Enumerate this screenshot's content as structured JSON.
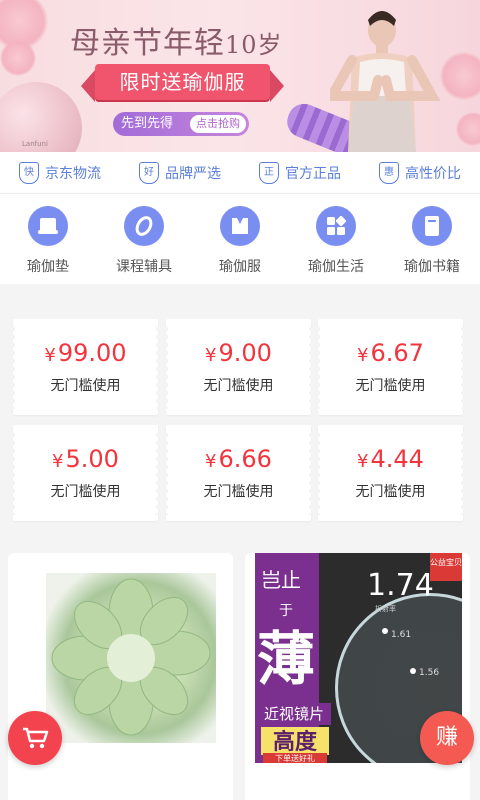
{
  "banner": {
    "headline": "母亲节年轻",
    "headline_num": "10岁",
    "ribbon": "限时送瑜伽服",
    "promo_text": "先到先得",
    "promo_button": "点击抢购",
    "ball_brand": "Lanfuni"
  },
  "features": [
    {
      "icon": "快",
      "label": "京东物流"
    },
    {
      "icon": "好",
      "label": "品牌严选"
    },
    {
      "icon": "正",
      "label": "官方正品"
    },
    {
      "icon": "惠",
      "label": "高性价比"
    }
  ],
  "categories": [
    {
      "label": "瑜伽垫",
      "icon": "yoga-mat-icon"
    },
    {
      "label": "课程辅具",
      "icon": "ring-icon"
    },
    {
      "label": "瑜伽服",
      "icon": "clothing-icon"
    },
    {
      "label": "瑜伽生活",
      "icon": "grid-icon"
    },
    {
      "label": "瑜伽书籍",
      "icon": "book-icon"
    }
  ],
  "coupons": [
    {
      "currency": "¥",
      "amount": "99.00",
      "desc": "无门槛使用"
    },
    {
      "currency": "¥",
      "amount": "9.00",
      "desc": "无门槛使用"
    },
    {
      "currency": "¥",
      "amount": "6.67",
      "desc": "无门槛使用"
    },
    {
      "currency": "¥",
      "amount": "5.00",
      "desc": "无门槛使用"
    },
    {
      "currency": "¥",
      "amount": "6.66",
      "desc": "无门槛使用"
    },
    {
      "currency": "¥",
      "amount": "4.44",
      "desc": "无门槛使用"
    }
  ],
  "product_ad": {
    "corner_badge": "公益宝贝",
    "line1": "岂止",
    "line2": "于",
    "big": "薄",
    "index": "1.74",
    "index_sub": "折射率",
    "index_mid": "1.61",
    "index_low": "1.56",
    "caption1": "近视镜片",
    "caption2": "高度",
    "caption3": "下单送好礼"
  },
  "earn_button": "赚",
  "colors": {
    "accent_blue": "#5c7fd9",
    "coupon_red": "#f2353d",
    "ribbon_pink": "#f0556d"
  }
}
